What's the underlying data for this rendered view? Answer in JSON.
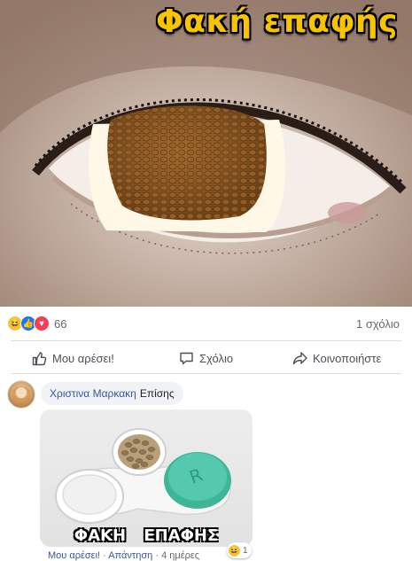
{
  "post": {
    "image_caption": "Φακή επαφής",
    "reactions": {
      "icons": [
        "haha-reaction-icon",
        "like-reaction-icon",
        "love-reaction-icon"
      ],
      "count": "66"
    },
    "comments_count": "1 σχόλιο",
    "actions": {
      "like": "Μου αρέσει!",
      "comment": "Σχόλιο",
      "share": "Κοινοποιήστε"
    }
  },
  "comment": {
    "author": "Χριστινα Μαρκακη",
    "text": "Επίσης",
    "image_caption": "ΦΑΚΗ ΕΠΑΦΗΣ",
    "like_link": "Μου αρέσει!",
    "separator": "·",
    "reply_link": "Απάντηση",
    "time": "4 ημέρες",
    "reaction_count": "1"
  },
  "colors": {
    "accent_link": "#385898",
    "caption_yellow": "#f6c400",
    "lens_case_teal": "#4fc3a8"
  }
}
